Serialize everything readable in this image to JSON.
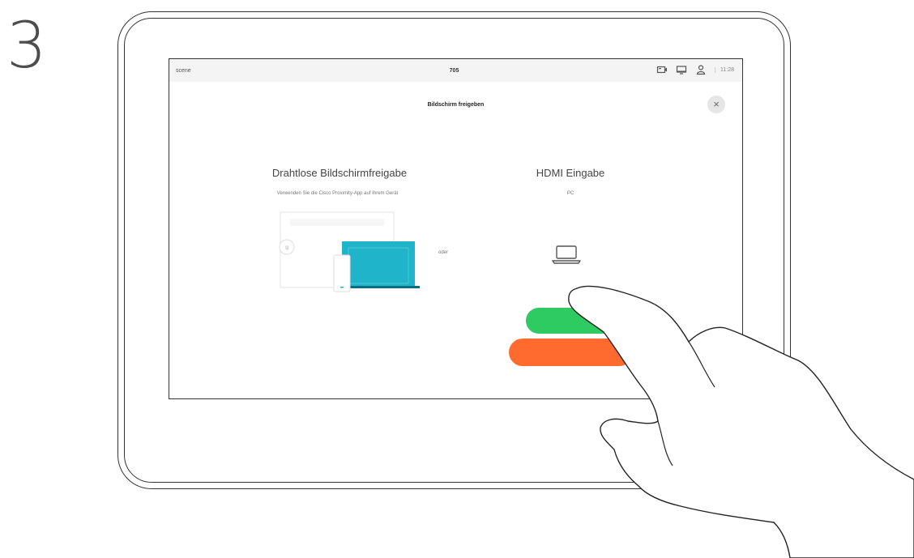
{
  "step_number": "3",
  "topbar": {
    "left_text": "scene",
    "center_main": "705",
    "center_sub": "",
    "time": "11:28"
  },
  "panel": {
    "title": "Bildschirm freigeben",
    "close": "×"
  },
  "wireless": {
    "title": "Drahtlose Bildschirmfreigabe",
    "subtitle": "Verwenden Sie die Cisco Proximity-App auf Ihrem Gerät"
  },
  "or_label": "oder",
  "hdmi": {
    "title": "HDMI Eingabe",
    "subtitle": "PC"
  },
  "buttons": {
    "green": "",
    "orange": ""
  },
  "colors": {
    "accent_green": "#2ecb62",
    "accent_orange": "#ff6b2e",
    "illustration_cyan": "#1fb4c9"
  }
}
